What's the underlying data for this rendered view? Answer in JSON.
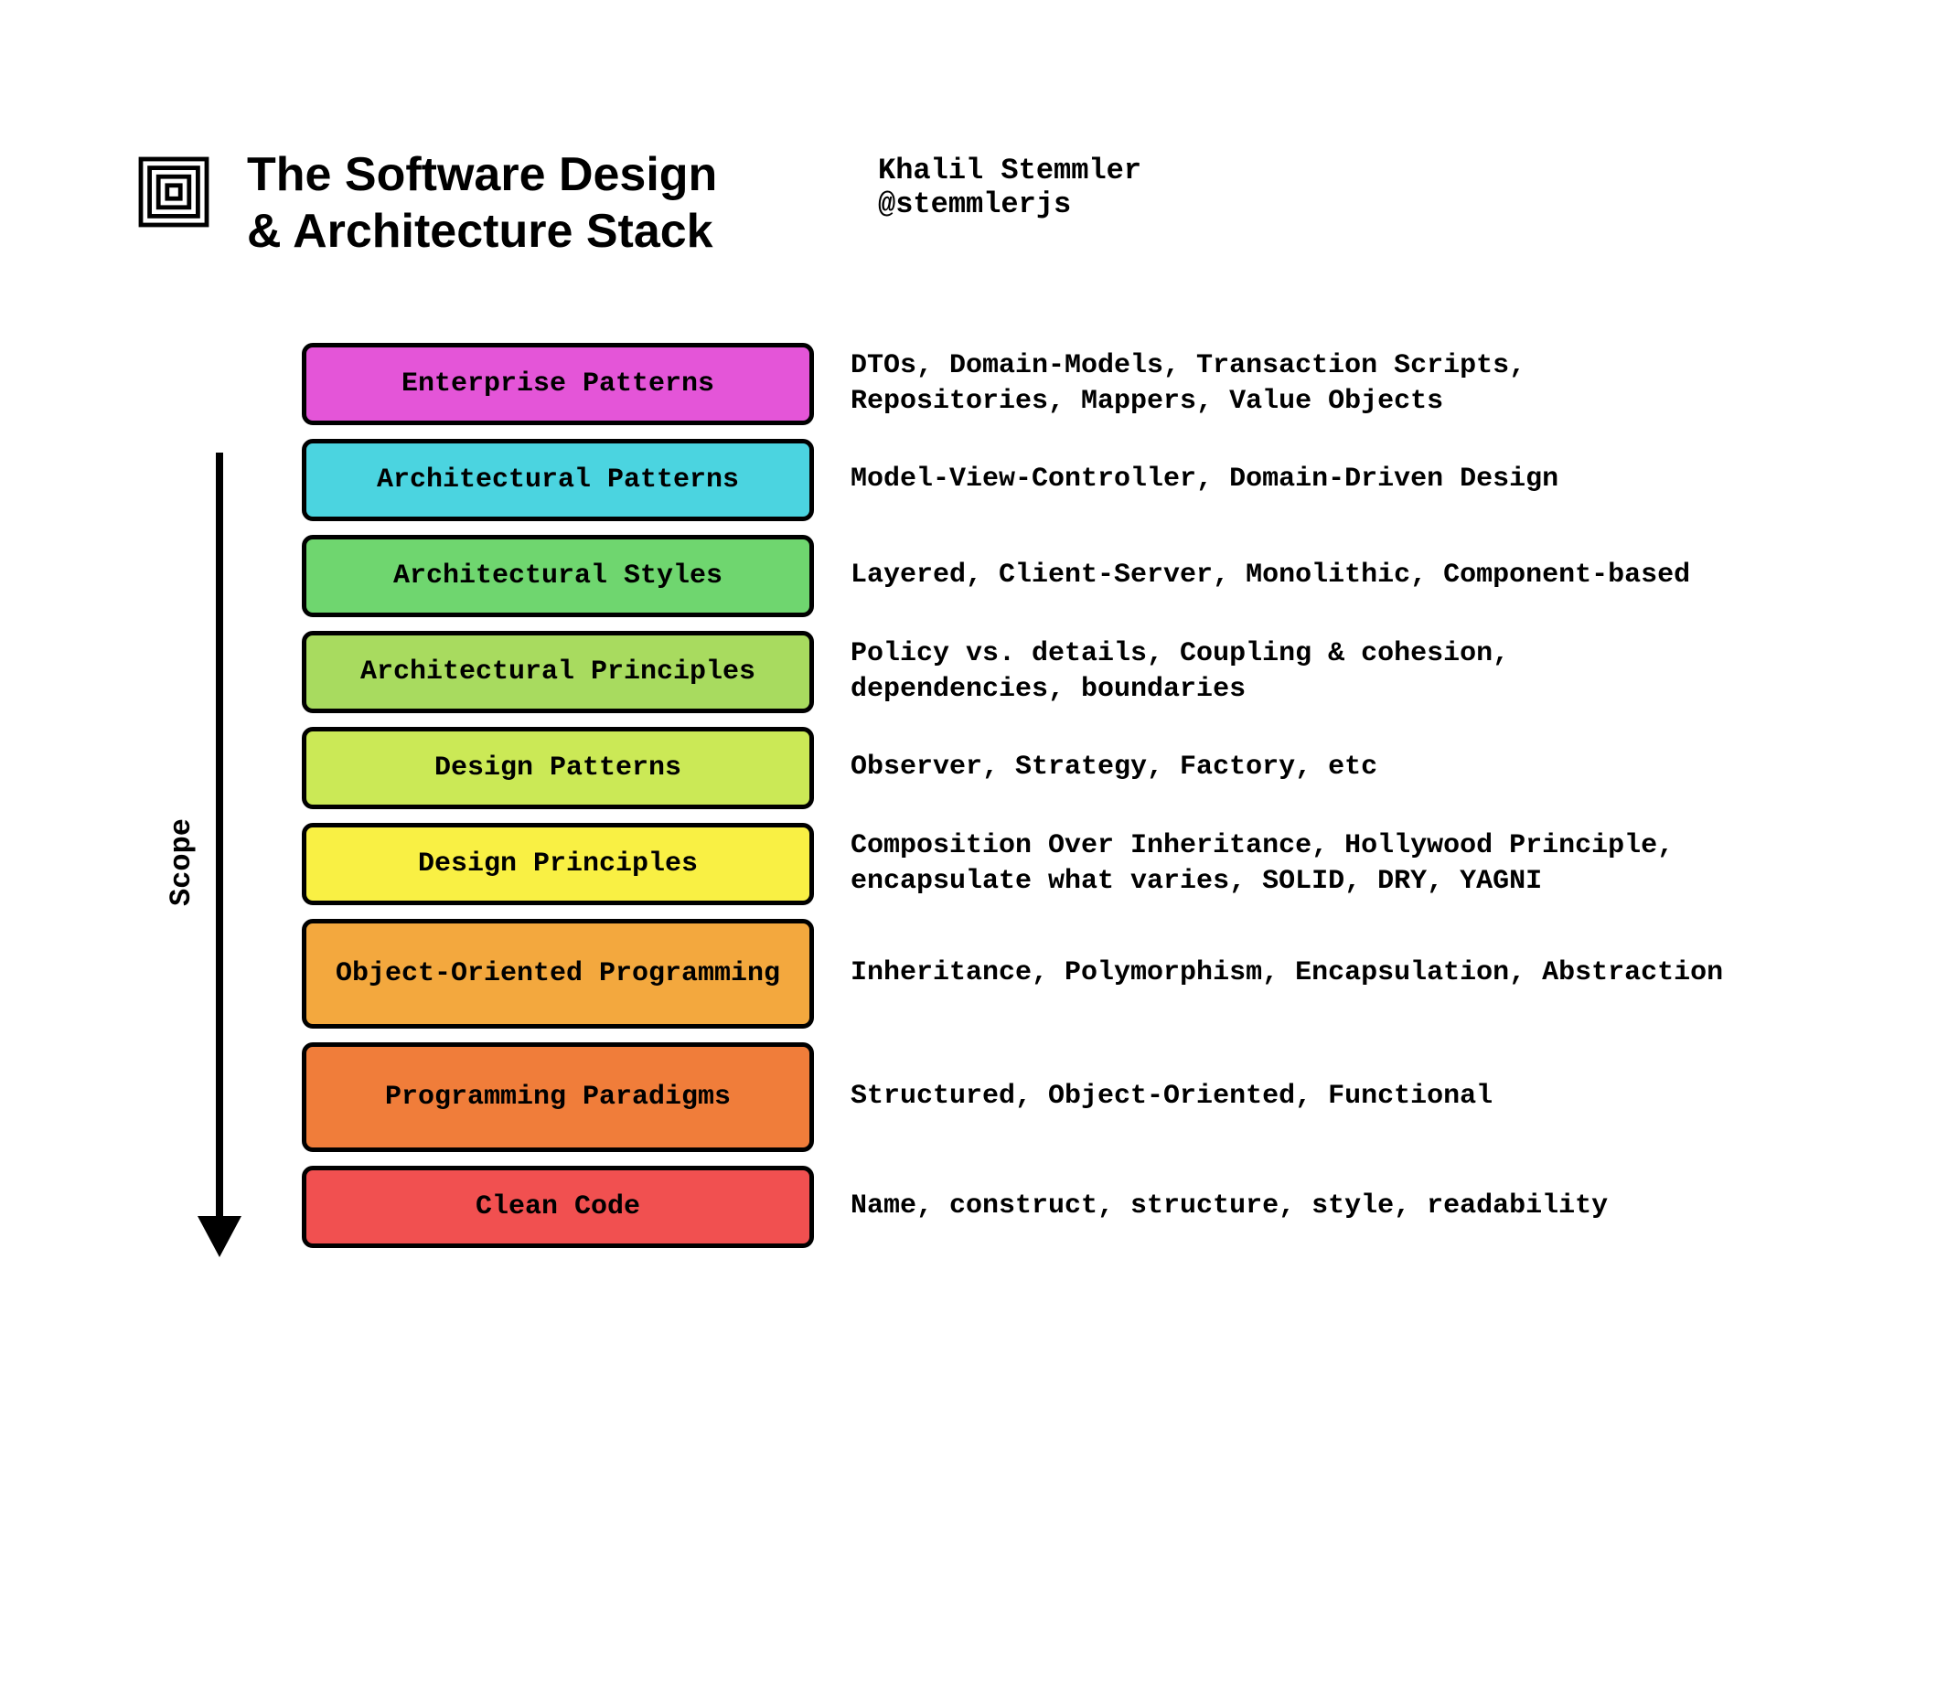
{
  "header": {
    "title_line1": "The Software Design",
    "title_line2": "& Architecture Stack",
    "author_name": "Khalil Stemmler",
    "author_handle": "@stemmlerjs"
  },
  "scope_label": "Scope",
  "stack": [
    {
      "label": "Enterprise Patterns",
      "description": "DTOs, Domain-Models, Transaction Scripts, Repositories, Mappers, Value Objects",
      "color": "#E455D8",
      "tall": false
    },
    {
      "label": "Architectural Patterns",
      "description": "Model-View-Controller, Domain-Driven Design",
      "color": "#4BD4E0",
      "tall": false
    },
    {
      "label": "Architectural Styles",
      "description": "Layered, Client-Server, Monolithic, Component-based",
      "color": "#6FD66F",
      "tall": false
    },
    {
      "label": "Architectural Principles",
      "description": "Policy vs. details, Coupling & cohesion, dependencies, boundaries",
      "color": "#A8DB5F",
      "tall": false
    },
    {
      "label": "Design Patterns",
      "description": "Observer, Strategy, Factory, etc",
      "color": "#CBE956",
      "tall": false
    },
    {
      "label": "Design Principles",
      "description": "Composition Over Inheritance, Hollywood Principle, encapsulate what varies, SOLID, DRY, YAGNI",
      "color": "#F9F044",
      "tall": false
    },
    {
      "label": "Object-Oriented Programming",
      "description": "Inheritance, Polymorphism, Encapsulation, Abstraction",
      "color": "#F3A83E",
      "tall": true
    },
    {
      "label": "Programming Paradigms",
      "description": "Structured, Object-Oriented, Functional",
      "color": "#F07D3A",
      "tall": true
    },
    {
      "label": "Clean Code",
      "description": "Name, construct, structure, style, readability",
      "color": "#F15050",
      "tall": false
    }
  ]
}
